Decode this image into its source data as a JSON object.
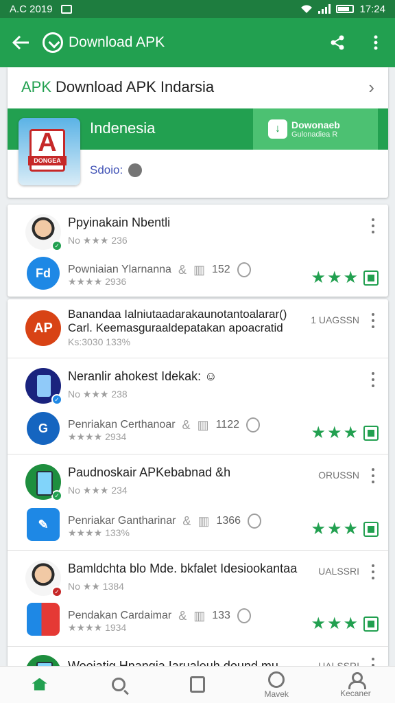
{
  "status_bar": {
    "carrier": "A.C 2019",
    "time": "17:24"
  },
  "app_bar": {
    "title": "Download APK"
  },
  "hero": {
    "brand": "APK",
    "header_text": "Download APK Indarsia",
    "band_title": "Indenesia",
    "button_line1": "Dowonaeb",
    "button_line2": "Gulonadiea R",
    "icon_letter": "A",
    "icon_strip": "DONGEA",
    "sub_label": "Sdoio:"
  },
  "rows": [
    {
      "title": "Ppyinakain Nbentli",
      "meta": "No ★★★ 236",
      "sub_label": "Powniaian Ylarnanna",
      "sub_count": "152",
      "sub_meta": "★★★★ 2936",
      "sub_icon_text": "Fd"
    },
    {
      "title": "Banandaa Ialniutaadarakaunotantoalarar()",
      "title2": "Carl. Keemasguraaldepatakan apoacratid",
      "meta": "Ks:3030 133%",
      "code": "1 UAGSSN",
      "icon_text": "AP"
    },
    {
      "title": "Neranlir ahokest Idekak:",
      "meta": "No ★★★ 238",
      "sub_label": "Penriakan Certhanoar",
      "sub_count": "1122",
      "sub_meta": "★★★★ 2934"
    },
    {
      "title": "Paudnoskair APKebabnad &h",
      "meta": "No ★★★ 234",
      "code": "ORUSSN",
      "sub_label": "Penriakar Gantharinar",
      "sub_count": "1366",
      "sub_meta": "★★★★ 133%"
    },
    {
      "title": "Bamldchta blo Mde. bkfalet Idesiookantaa",
      "meta": "No ★★ 1384",
      "code": "UALSSRI",
      "sub_label": "Pendakan Cardaimar",
      "sub_count": "133",
      "sub_meta": "★★★★ 1934"
    },
    {
      "title": "Woojatig Hnangia Iarualeuh dound mu",
      "code": "UALSSRI"
    }
  ],
  "bottom_nav": [
    "",
    "",
    "",
    "Mavek",
    "Kecaner"
  ]
}
